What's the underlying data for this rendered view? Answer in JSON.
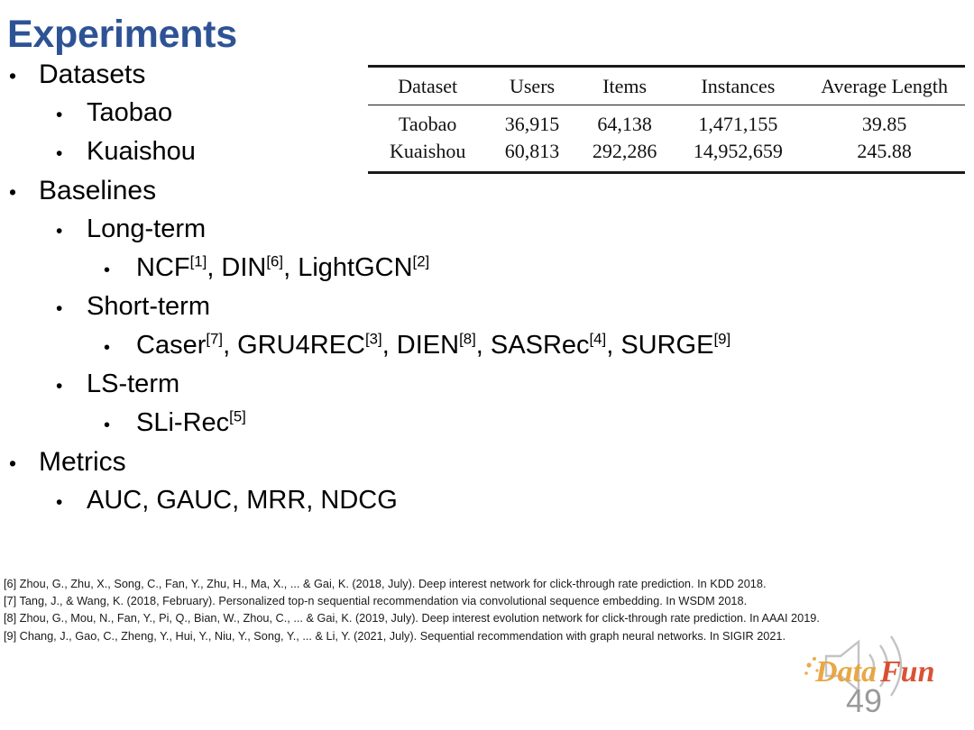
{
  "slide": {
    "title": "Experiments",
    "title_color": "#2E5395",
    "page_number": "49"
  },
  "outline": [
    {
      "level": 1,
      "marker": "•",
      "text": "Datasets"
    },
    {
      "level": 2,
      "marker": "•",
      "text": "Taobao"
    },
    {
      "level": 2,
      "marker": "•",
      "text": "Kuaishou"
    },
    {
      "level": 1,
      "marker": "•",
      "text": "Baselines"
    },
    {
      "level": 2,
      "marker": "•",
      "text": "Long-term"
    },
    {
      "level": 3,
      "marker": "•",
      "text": "NCF[1], DIN[6], LightGCN[2]",
      "runs": [
        {
          "t": "NCF"
        },
        {
          "t": "[1]",
          "sup": true
        },
        {
          "t": ", DIN"
        },
        {
          "t": "[6]",
          "sup": true
        },
        {
          "t": ", LightGCN"
        },
        {
          "t": "[2]",
          "sup": true
        }
      ]
    },
    {
      "level": 2,
      "marker": "•",
      "text": "Short-term"
    },
    {
      "level": 3,
      "marker": "•",
      "text": "Caser[7], GRU4REC[3], DIEN[8], SASRec[4], SURGE[9]",
      "runs": [
        {
          "t": "Caser"
        },
        {
          "t": "[7]",
          "sup": true
        },
        {
          "t": ", GRU4REC"
        },
        {
          "t": "[3]",
          "sup": true
        },
        {
          "t": ", DIEN"
        },
        {
          "t": "[8]",
          "sup": true
        },
        {
          "t": ", SASRec"
        },
        {
          "t": "[4]",
          "sup": true
        },
        {
          "t": ", SURGE"
        },
        {
          "t": "[9]",
          "sup": true
        }
      ]
    },
    {
      "level": 2,
      "marker": "•",
      "text": "LS-term"
    },
    {
      "level": 3,
      "marker": "•",
      "text": "SLi-Rec[5]",
      "runs": [
        {
          "t": "SLi-Rec"
        },
        {
          "t": "[5]",
          "sup": true
        }
      ]
    },
    {
      "level": 1,
      "marker": "•",
      "text": "Metrics"
    },
    {
      "level": 2,
      "marker": "•",
      "text": "AUC, GAUC, MRR, NDCG"
    }
  ],
  "table": {
    "headers": [
      "Dataset",
      "Users",
      "Items",
      "Instances",
      "Average Length"
    ],
    "rows": [
      [
        "Taobao",
        "36,915",
        "64,138",
        "1,471,155",
        "39.85"
      ],
      [
        "Kuaishou",
        "60,813",
        "292,286",
        "14,952,659",
        "245.88"
      ]
    ]
  },
  "references": [
    "[6] Zhou, G., Zhu, X., Song, C., Fan, Y., Zhu, H., Ma, X., ... & Gai, K. (2018, July). Deep interest network for click-through rate prediction. In KDD 2018.",
    "[7] Tang, J., & Wang, K. (2018, February). Personalized top-n sequential recommendation via convolutional sequence embedding. In WSDM 2018.",
    "[8] Zhou, G., Mou, N., Fan, Y., Pi, Q., Bian, W., Zhou, C., ... & Gai, K. (2019, July). Deep interest evolution network for click-through rate prediction. In AAAI 2019.",
    "[9] Chang, J., Gao, C., Zheng, Y., Hui, Y., Niu, Y., Song, Y., ... & Li, Y. (2021, July). Sequential recommendation with graph neural networks. In SIGIR 2021."
  ],
  "watermark": {
    "text_data": "Data",
    "text_fun": "Fun",
    "color_data": "#E8A33D",
    "color_fun": "#D9492B",
    "icon": "speaker-icon"
  }
}
